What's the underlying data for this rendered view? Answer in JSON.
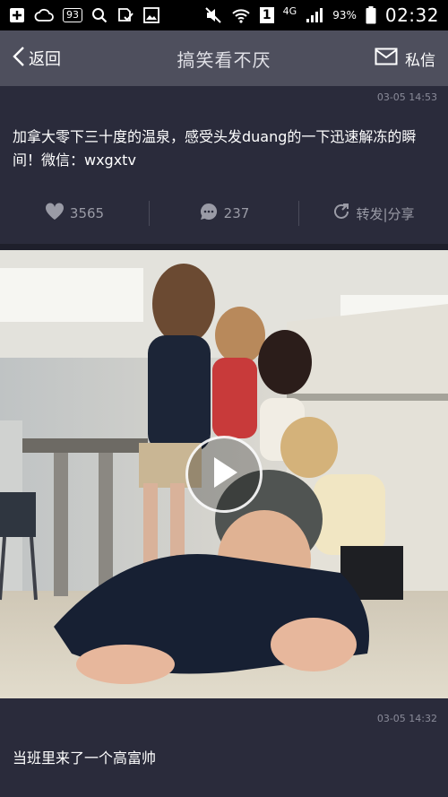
{
  "status_bar": {
    "notification_count": "93",
    "network": "4G",
    "sim": "1",
    "battery": "93%",
    "time": "02:32"
  },
  "nav": {
    "back_label": "返回",
    "title": "搞笑看不厌",
    "message_label": "私信"
  },
  "posts": [
    {
      "time": "03-05 14:53",
      "text": "加拿大零下三十度的温泉，感受头发duang的一下迅速解冻的瞬间！微信：wxgxtv",
      "likes": "3565",
      "comments": "237",
      "share_label": "转发|分享"
    },
    {
      "time": "03-05 14:32",
      "text": "当班里来了一个高富帅"
    }
  ],
  "colors": {
    "background": "#2a2b3b",
    "nav_bar": "#4e4f5d",
    "muted_text": "#9a9ba6"
  }
}
